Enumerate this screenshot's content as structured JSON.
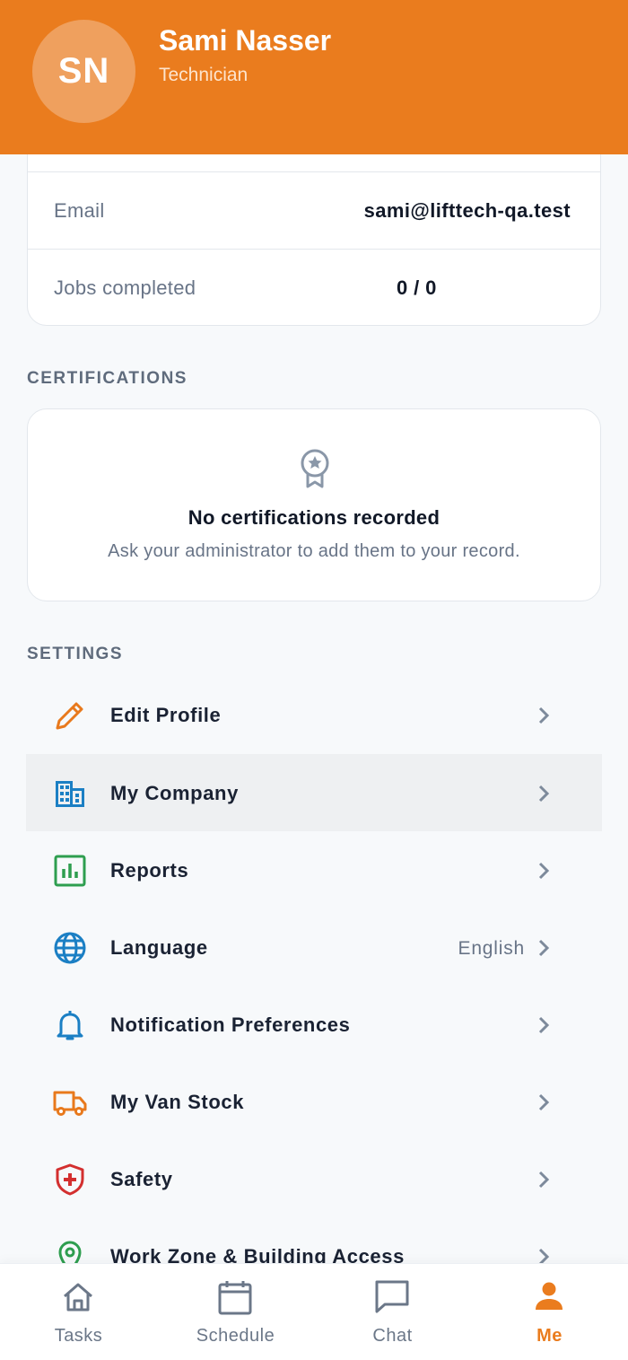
{
  "profile": {
    "initials": "SN",
    "name": "Sami Nasser",
    "role": "Technician"
  },
  "info": {
    "email_label": "Email",
    "email_value": "sami@lifttech-qa.test",
    "jobs_label": "Jobs completed",
    "jobs_value": "0 / 0"
  },
  "certifications": {
    "section_title": "CERTIFICATIONS",
    "empty_title": "No certifications recorded",
    "empty_subtitle": "Ask your administrator to add them to your record.",
    "icon": "award-badge-icon"
  },
  "settings": {
    "section_title": "SETTINGS",
    "items": [
      {
        "label": "Edit Profile",
        "icon": "pencil-icon",
        "color": "#e8791c"
      },
      {
        "label": "My Company",
        "icon": "building-icon",
        "color": "#1b7fc4"
      },
      {
        "label": "Reports",
        "icon": "bar-chart-icon",
        "color": "#2e9e4f"
      },
      {
        "label": "Language",
        "value": "English",
        "icon": "globe-icon",
        "color": "#1b7fc4"
      },
      {
        "label": "Notification Preferences",
        "icon": "bell-icon",
        "color": "#1b7fc4"
      },
      {
        "label": "My Van Stock",
        "icon": "truck-icon",
        "color": "#e8791c"
      },
      {
        "label": "Safety",
        "icon": "shield-plus-icon",
        "color": "#d32f2f"
      },
      {
        "label": "Work Zone & Building Access",
        "icon": "map-pin-icon",
        "color": "#2e9e4f"
      }
    ]
  },
  "tabs": [
    {
      "label": "Tasks",
      "icon": "home-icon"
    },
    {
      "label": "Schedule",
      "icon": "calendar-icon"
    },
    {
      "label": "Chat",
      "icon": "chat-icon"
    },
    {
      "label": "Me",
      "icon": "person-icon",
      "active": true
    }
  ],
  "colors": {
    "brand": "#ea7c1e",
    "background": "#f7f9fb",
    "muted_text": "#687487"
  }
}
